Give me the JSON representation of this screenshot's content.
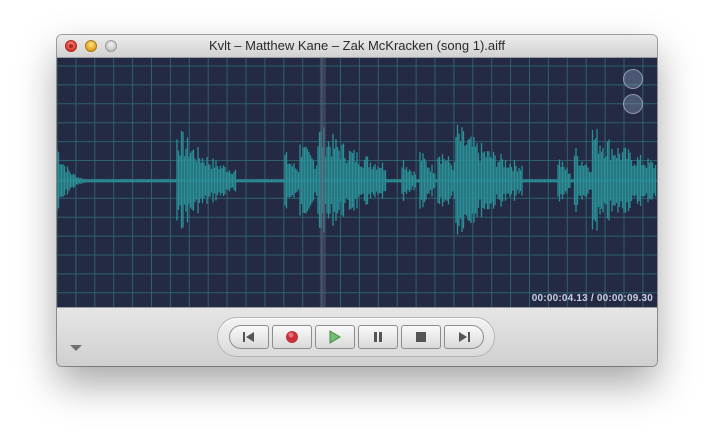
{
  "window": {
    "title": "Kvlt – Matthew Kane – Zak McKracken (song 1).aiff"
  },
  "display": {
    "timecode": "00:00:04.13 / 00:00:09.30",
    "colors": {
      "background": "#242a44",
      "grid": "#2f6a74",
      "waveform": "#2b8f98",
      "playhead": "#5a6278"
    },
    "playhead_position": 0.443
  },
  "controls": {
    "buttons": [
      {
        "name": "skip-to-start",
        "icon": "skip-back-icon"
      },
      {
        "name": "record",
        "icon": "record-icon"
      },
      {
        "name": "play",
        "icon": "play-icon"
      },
      {
        "name": "pause",
        "icon": "pause-icon"
      },
      {
        "name": "stop",
        "icon": "stop-icon"
      },
      {
        "name": "skip-to-end",
        "icon": "skip-forward-icon"
      }
    ],
    "menu_icon": "disclosure-triangle-icon"
  }
}
